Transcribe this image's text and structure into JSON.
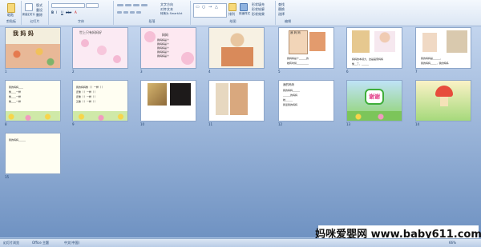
{
  "ribbon": {
    "groups": [
      "剪贴板",
      "幻灯片",
      "字体",
      "段落",
      "绘图",
      "编辑"
    ],
    "clipboard": {
      "paste": "粘贴"
    },
    "slides": {
      "new_slide": "新建幻灯片",
      "layout": "版式",
      "reset": "重设",
      "delete": "删除"
    },
    "paragraph": {
      "text_direction": "文字方向",
      "align_text": "对齐文本",
      "smartart": "转换为 SmartArt"
    },
    "drawing": {
      "arrange": "排列",
      "quick_styles": "快速样式",
      "fill": "形状填充",
      "outline": "形状轮廓",
      "effects": "形状效果"
    },
    "editing": {
      "find": "查找",
      "replace": "替换",
      "select": "选择"
    }
  },
  "slides": [
    {
      "num": "1",
      "title": "我 妈 妈"
    },
    {
      "num": "2",
      "title": "世上只有妈妈好"
    },
    {
      "num": "3",
      "title": "妈妈",
      "lines": [
        "我妈妈是个",
        "我妈妈是个",
        "我妈妈是个",
        "我妈妈是个",
        "我妈妈是个"
      ]
    },
    {
      "num": "4"
    },
    {
      "num": "5",
      "title": "我 妈 妈",
      "lines": [
        "我妈妈是个______的",
        "她有时候__________"
      ]
    },
    {
      "num": "6",
      "lines": [
        "妈妈的本领大，这是画家妈妈",
        "像__了，______"
      ]
    },
    {
      "num": "7",
      "lines": [
        "我的妈妈是______，",
        "我的妈妈_____，我的妈妈"
      ]
    },
    {
      "num": "8",
      "lines": [
        "我的妈妈____",
        "像____一样",
        "像____一样",
        "像____一样"
      ]
    },
    {
      "num": "9",
      "lines": [
        "我的妈妈像（  ）一样（  ）",
        "还像（  ）一样（  ）",
        "还像（  ）一样（  ）",
        "又像（  ）一样（  ）"
      ]
    },
    {
      "num": "10"
    },
    {
      "num": "11"
    },
    {
      "num": "12",
      "title": "我的妈妈",
      "lines": [
        "我的妈妈______",
        "______的妈妈",
        "她______",
        "我爱我的妈妈"
      ]
    },
    {
      "num": "13",
      "title": "谢谢"
    },
    {
      "num": "14"
    },
    {
      "num": "15",
      "lines": [
        "我的妈妈______"
      ]
    }
  ],
  "watermark": "妈咪爱婴网 www.baby611.com",
  "status": {
    "slide_sorter": "幻灯片浏览",
    "theme": "Office 主题",
    "lang": "中文(中国)",
    "zoom": "66%"
  }
}
